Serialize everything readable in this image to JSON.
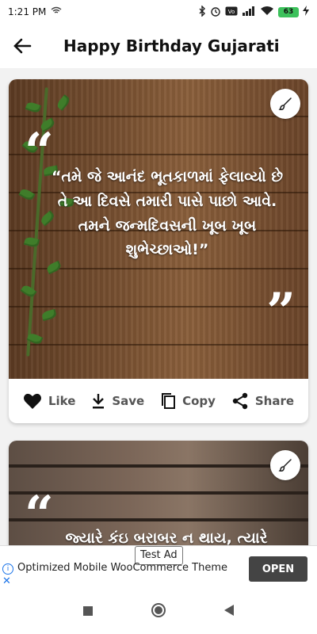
{
  "status": {
    "time": "1:21 PM",
    "battery": "63"
  },
  "appbar": {
    "title": "Happy Birthday Gujarati"
  },
  "cards": [
    {
      "quote": "“તમે જે આનંદ ભૂતકાળમાં ફેલાવ્યો છે તે આ દિવસે તમારી પાસે પાછો આવે. તમને જન્મદિવસની ખૂબ ખૂબ શુભેચ્છાઓ!”",
      "actions": {
        "like": "Like",
        "save": "Save",
        "copy": "Copy",
        "share": "Share"
      }
    },
    {
      "quote": "જ્યારે કંઇ બરાબર ન થાય, ત્યારે"
    }
  ],
  "ad": {
    "tag": "Test Ad",
    "text": "Optimized Mobile WooCommerce Theme",
    "cta": "OPEN"
  },
  "colors": {
    "accent": "#444444",
    "battery": "#3cc15b",
    "ad_info": "#1a73e8"
  }
}
